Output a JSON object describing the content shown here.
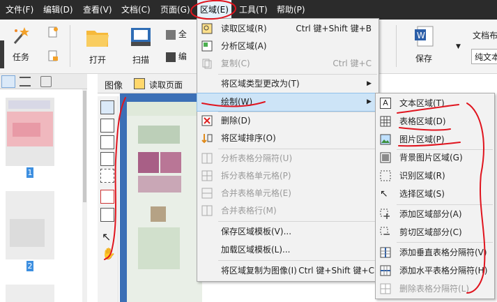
{
  "menubar": {
    "items": [
      "文件(F)",
      "编辑(D)",
      "查看(V)",
      "文档(C)",
      "页面(G)",
      "区域(E)",
      "工具(T)",
      "帮助(P)"
    ]
  },
  "ribbon": {
    "task": "任务",
    "open": "打开",
    "scan": "扫描",
    "select_all": "全",
    "edit": "编",
    "save": "保存",
    "doc_layout": "文档布",
    "plain_text": "纯文本"
  },
  "image_toolbar": {
    "image_label": "图像",
    "read_page": "读取页面"
  },
  "thumbnails": {
    "pages": [
      "1",
      "2"
    ]
  },
  "region_menu": {
    "items": [
      {
        "label": "读取区域(R)",
        "shortcut": "Ctrl 键+Shift 键+B",
        "icon": "read-region-icon"
      },
      {
        "label": "分析区域(A)",
        "shortcut": "",
        "icon": "analyze-region-icon"
      },
      {
        "label": "复制(C)",
        "shortcut": "Ctrl 键+C",
        "icon": "copy-icon"
      },
      {
        "label": "将区域类型更改为(T)",
        "shortcut": "",
        "icon": ""
      },
      {
        "label": "绘制(W)",
        "shortcut": "",
        "icon": ""
      },
      {
        "label": "删除(D)",
        "shortcut": "",
        "icon": "delete-icon"
      },
      {
        "label": "将区域排序(O)",
        "shortcut": "",
        "icon": "sort-region-icon"
      },
      {
        "label": "分析表格分隔符(U)",
        "shortcut": "",
        "icon": "analyze-separator-icon"
      },
      {
        "label": "拆分表格单元格(P)",
        "shortcut": "",
        "icon": "split-cells-icon"
      },
      {
        "label": "合并表格单元格(E)",
        "shortcut": "",
        "icon": "merge-cells-icon"
      },
      {
        "label": "合并表格行(M)",
        "shortcut": "",
        "icon": "merge-rows-icon"
      },
      {
        "label": "保存区域模板(V)...",
        "shortcut": "",
        "icon": ""
      },
      {
        "label": "加载区域模板(L)...",
        "shortcut": "",
        "icon": ""
      },
      {
        "label": "将区域复制为图像(I)",
        "shortcut": "Ctrl 键+Shift 键+C",
        "icon": ""
      }
    ]
  },
  "draw_submenu": {
    "items": [
      {
        "label": "文本区域(T)",
        "icon": "text-region-icon"
      },
      {
        "label": "表格区域(D)",
        "icon": "table-region-icon"
      },
      {
        "label": "图片区域(P)",
        "icon": "picture-region-icon"
      },
      {
        "label": "背景图片区域(G)",
        "icon": "background-picture-region-icon"
      },
      {
        "label": "识别区域(R)",
        "icon": "recognition-region-icon"
      },
      {
        "label": "选择区域(S)",
        "icon": "select-region-icon"
      },
      {
        "label": "添加区域部分(A)",
        "icon": "add-region-part-icon"
      },
      {
        "label": "剪切区域部分(C)",
        "icon": "cut-region-part-icon"
      },
      {
        "label": "添加垂直表格分隔符(V)",
        "icon": "add-vertical-separator-icon"
      },
      {
        "label": "添加水平表格分隔符(H)",
        "icon": "add-horizontal-separator-icon"
      },
      {
        "label": "删除表格分隔符(L)",
        "icon": "delete-separator-icon"
      }
    ]
  },
  "colors": {
    "highlight": "#cde4f7",
    "annotation_red": "#e0141e",
    "menubar": "#2b2b2b",
    "canvas_blue": "#3b6fb6"
  }
}
